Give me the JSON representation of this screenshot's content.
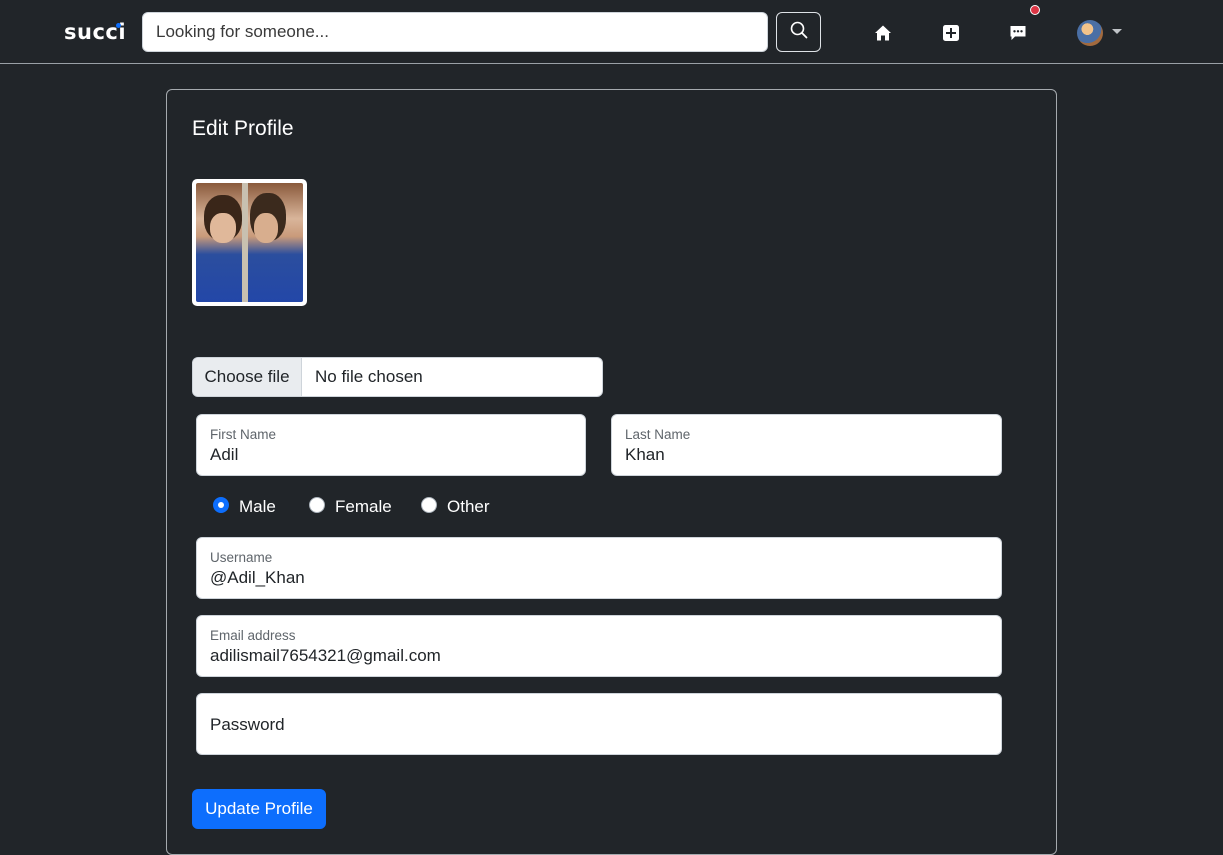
{
  "navbar": {
    "brand": "succi",
    "search_placeholder": "Looking for someone...",
    "icons": [
      "search-icon",
      "home-icon",
      "add-post-icon",
      "messages-icon",
      "avatar",
      "chevron-down-icon"
    ],
    "notification_color": "#dc3545"
  },
  "form": {
    "title": "Edit Profile",
    "file_button": "Choose file",
    "file_status": "No file chosen",
    "first_name": {
      "label": "First Name",
      "value": "Adil"
    },
    "last_name": {
      "label": "Last Name",
      "value": "Khan"
    },
    "gender": {
      "options": [
        "Male",
        "Female",
        "Other"
      ],
      "selected": "Male"
    },
    "username": {
      "label": "Username",
      "value": "@Adil_Khan"
    },
    "email": {
      "label": "Email address",
      "value": "adilismail7654321@gmail.com"
    },
    "password": {
      "placeholder": "Password"
    },
    "submit_label": "Update Profile"
  },
  "colors": {
    "background": "#212529",
    "accent": "#0d6efd"
  }
}
